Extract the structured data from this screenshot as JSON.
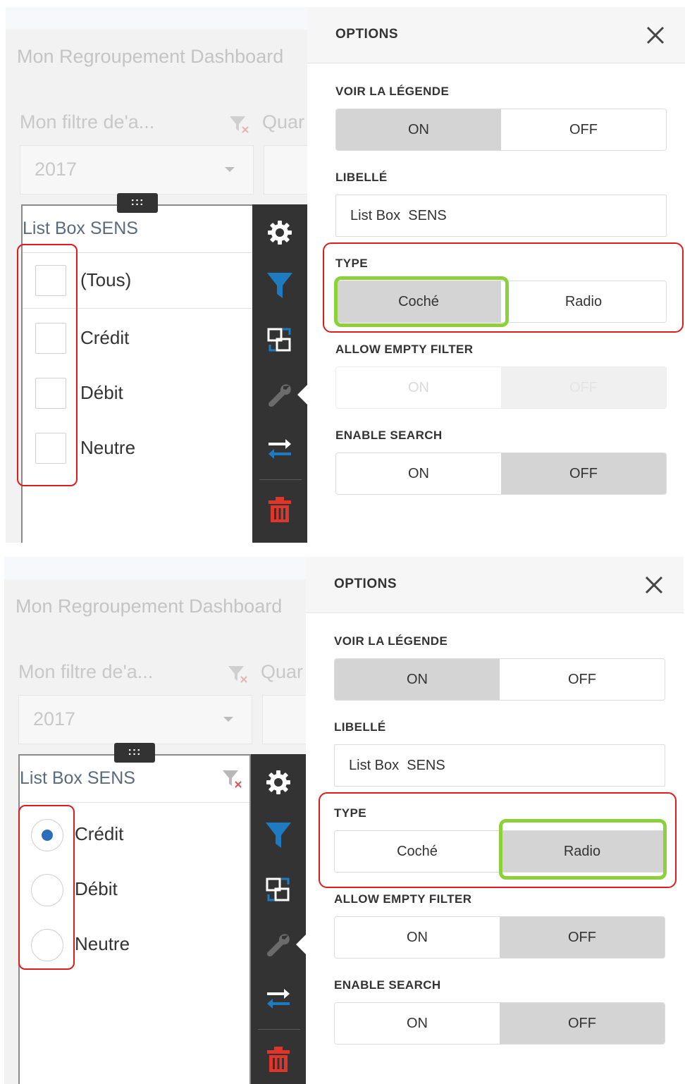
{
  "shots": [
    {
      "dashboard": {
        "title": "Mon Regroupement Dashboard",
        "filter_title": "Mon filtre de'a...",
        "second_filter_title": "Quar",
        "year_value": "2017",
        "drag_handle": ":::"
      },
      "listbox": {
        "title": "List Box SENS",
        "mode": "checkbox",
        "items": [
          {
            "label": "(Tous)",
            "checked": false
          },
          {
            "label": "Crédit",
            "checked": false
          },
          {
            "label": "Débit",
            "checked": false
          },
          {
            "label": "Neutre",
            "checked": false
          }
        ]
      },
      "toolbar": {
        "buttons": [
          "gear-icon",
          "filter-icon",
          "swap-view-icon",
          "wrench-icon",
          "arrows-swap-icon",
          "trash-icon"
        ],
        "colors": {
          "filter": "#1f7bc1",
          "trash": "#e0352b",
          "gear": "#ffffff"
        }
      },
      "options": {
        "title": "OPTIONS",
        "close": "×",
        "voir_legende": {
          "label": "VOIR LA LÉGENDE",
          "on": "ON",
          "off": "OFF",
          "selected": "on"
        },
        "libelle": {
          "label": "LIBELLÉ",
          "value": "List Box  SENS"
        },
        "type": {
          "label": "TYPE",
          "coche": "Coché",
          "radio": "Radio",
          "selected": "coche"
        },
        "allow_empty": {
          "label": "ALLOW EMPTY FILTER",
          "on": "ON",
          "off": "OFF",
          "selected": "off",
          "disabled": true
        },
        "enable_search": {
          "label": "ENABLE SEARCH",
          "on": "ON",
          "off": "OFF",
          "selected": "off"
        }
      }
    },
    {
      "dashboard": {
        "title": "Mon Regroupement Dashboard",
        "filter_title": "Mon filtre de'a...",
        "second_filter_title": "Quar",
        "year_value": "2017",
        "drag_handle": ":::"
      },
      "listbox": {
        "title": "List Box SENS",
        "mode": "radio",
        "items": [
          {
            "label": "Crédit",
            "checked": true
          },
          {
            "label": "Débit",
            "checked": false
          },
          {
            "label": "Neutre",
            "checked": false
          }
        ]
      },
      "toolbar": {
        "buttons": [
          "gear-icon",
          "filter-icon",
          "swap-view-icon",
          "wrench-icon",
          "arrows-swap-icon",
          "trash-icon"
        ],
        "colors": {
          "filter": "#1f7bc1",
          "trash": "#e0352b",
          "gear": "#ffffff"
        }
      },
      "options": {
        "title": "OPTIONS",
        "close": "×",
        "voir_legende": {
          "label": "VOIR LA LÉGENDE",
          "on": "ON",
          "off": "OFF",
          "selected": "on"
        },
        "libelle": {
          "label": "LIBELLÉ",
          "value": "List Box  SENS"
        },
        "type": {
          "label": "TYPE",
          "coche": "Coché",
          "radio": "Radio",
          "selected": "radio"
        },
        "allow_empty": {
          "label": "ALLOW EMPTY FILTER",
          "on": "ON",
          "off": "OFF",
          "selected": "off",
          "disabled": false
        },
        "enable_search": {
          "label": "ENABLE SEARCH",
          "on": "ON",
          "off": "OFF",
          "selected": "off"
        }
      }
    }
  ],
  "annotation_colors": {
    "red": "#e01b1b",
    "green": "#8cd13b"
  }
}
